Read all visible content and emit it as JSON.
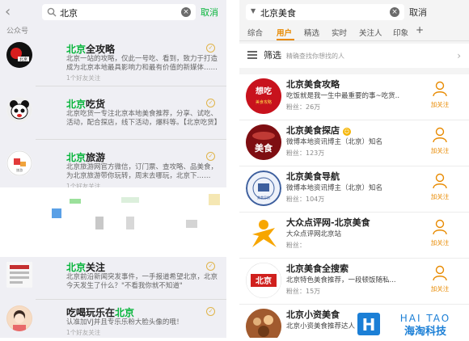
{
  "left": {
    "search": {
      "query": "北京",
      "cancel": "取消"
    },
    "section_label": "公众号",
    "accounts": [
      {
        "name_prefix": "北京",
        "name_suffix": "全攻略",
        "desc": "北京一站的攻略，仅此一号吃、看到，致力于打造成为北京本地最具影响力和最有价值的新媒体……",
        "meta": "1个好友关注"
      },
      {
        "name_prefix": "北京",
        "name_suffix": "吃货",
        "desc": "北京吃货一专注北京本地美食推荐，分享、试吃、活动，配合探店，线下活动，爆料等。【北京吃货】",
        "meta": ""
      },
      {
        "name_prefix": "北京",
        "name_suffix": "旅游",
        "desc": "北京旅游网官方微信，订门票、查攻略、品美食，为北京旅游带你玩转，周末去哪玩，北京下……",
        "meta": "1个好友关注"
      },
      {
        "name_prefix": "北京",
        "name_suffix": "关注",
        "desc": "北京前沿新闻突发事件，一手报道希望北京，北京今天发生了什么？\"不看我你就不知道\"",
        "meta": ""
      },
      {
        "name_prefix": "吃喝玩乐在",
        "name_suffix": "北京",
        "desc": "认准加VJ并且专乐乐粉大脸头像的哦！",
        "meta": "1个好友关注"
      }
    ]
  },
  "right": {
    "search": {
      "query": "北京美食",
      "cancel": "取消"
    },
    "tabs": [
      "综合",
      "用户",
      "精选",
      "实时",
      "关注人",
      "印象"
    ],
    "active_tab": "用户",
    "plus": "+",
    "filter": {
      "title": "筛选",
      "subtitle": "精确查找你想找的人"
    },
    "users": [
      {
        "name": "北京美食攻略",
        "desc": "吃饭就是我一生中最重要的事~吃货...",
        "fans": "粉丝：26万",
        "follow": "加关注"
      },
      {
        "name": "北京美食探店",
        "desc": "微博本地资讯博主（北京）知名",
        "fans": "粉丝：123万",
        "follow": "加关注"
      },
      {
        "name": "北京美食导航",
        "desc": "微博本地资讯博主（北京）知名",
        "fans": "粉丝：104万",
        "follow": "加关注"
      },
      {
        "name": "大众点评网-北京美食",
        "desc": "大众点评网北京站",
        "fans": "粉丝：",
        "follow": "加关注"
      },
      {
        "name": "北京美食全搜索",
        "desc": "北京特色美食推荐，一段顿饭随私...",
        "fans": "粉丝：15万",
        "follow": "加关注"
      },
      {
        "name": "北京小资美食",
        "desc": "北京小资美食推荐达人",
        "fans": "",
        "follow": "加关注"
      }
    ]
  },
  "watermark": {
    "line1": "HAI TAO",
    "line2": "海淘科技",
    "letter": "H"
  },
  "colors": {
    "wechat_green": "#07b53b",
    "weibo_orange": "#e88a00",
    "logo_blue": "#1b7fd6"
  }
}
